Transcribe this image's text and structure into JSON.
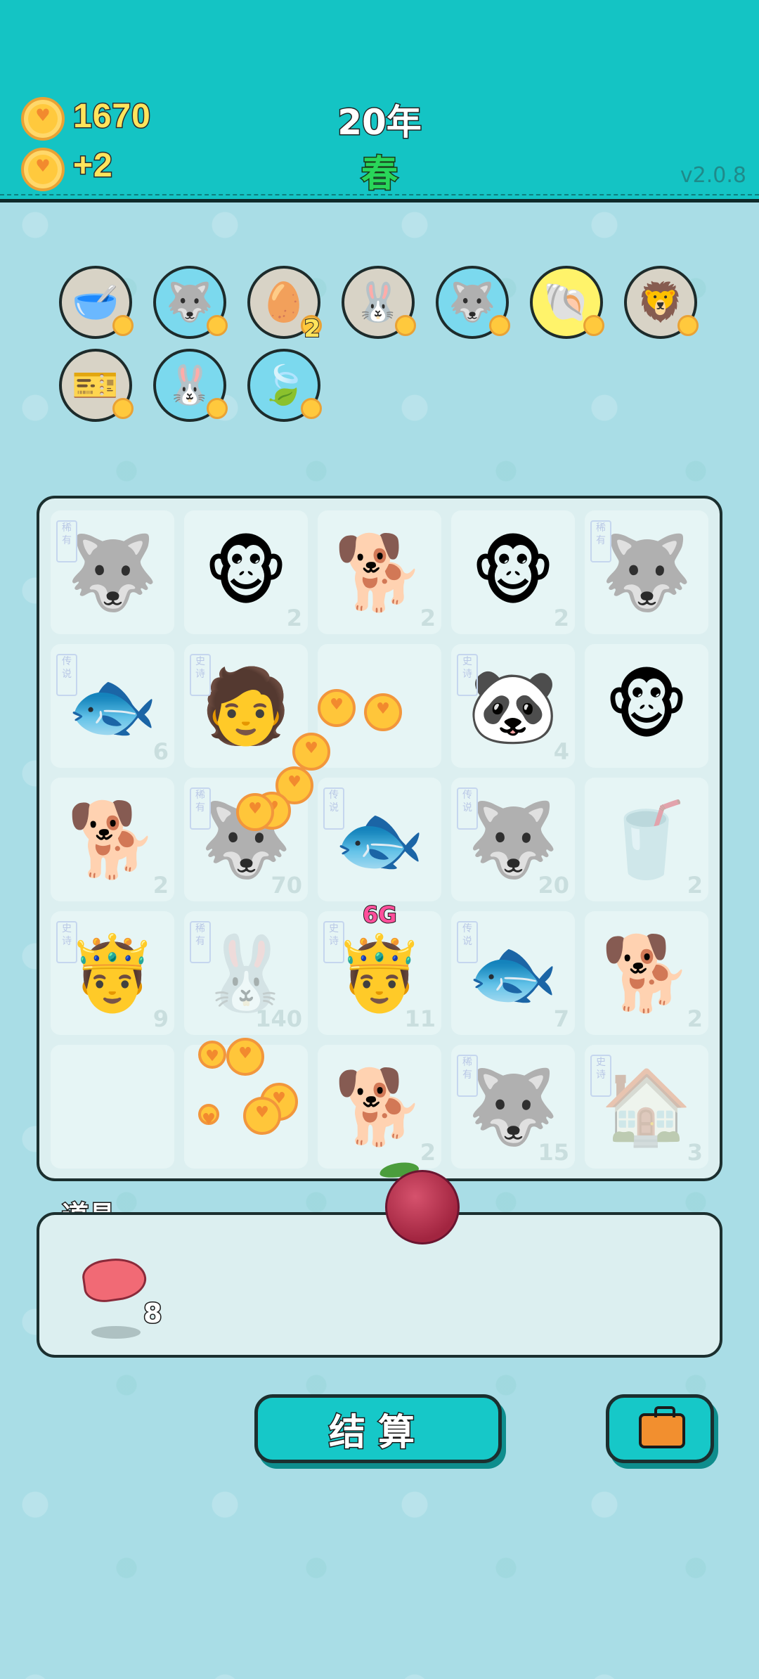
{
  "header": {
    "coins": "1670",
    "income": "+2",
    "year": "20年",
    "season": "春",
    "version": "v2.0.8"
  },
  "buffs": [
    {
      "icon": "🥣",
      "bg": "#d8d3c6"
    },
    {
      "icon": "🐺",
      "bg": "#7bd9ee"
    },
    {
      "icon": "🥚",
      "bg": "#d8d3c6",
      "count": "2"
    },
    {
      "icon": "🐰",
      "bg": "#d8d3c6"
    },
    {
      "icon": "🐺",
      "bg": "#7bd9ee"
    },
    {
      "icon": "🐚",
      "bg": "#fff36a"
    },
    {
      "icon": "🦁",
      "bg": "#d8d3c6"
    },
    {
      "icon": "🎫",
      "bg": "#d8d3c6"
    },
    {
      "icon": "🐰",
      "bg": "#7bd9ee"
    },
    {
      "icon": "🍃",
      "bg": "#7bd9ee"
    }
  ],
  "board": [
    [
      {
        "icon": "🐺",
        "level": "",
        "tag": "稀有"
      },
      {
        "icon": "🐵",
        "level": "2"
      },
      {
        "icon": "🐕",
        "level": "2"
      },
      {
        "icon": "🐵",
        "level": "2"
      },
      {
        "icon": "🐺",
        "level": "",
        "tag": "稀有"
      }
    ],
    [
      {
        "icon": "🐟",
        "level": "6",
        "tag": "传说"
      },
      {
        "icon": "🧑",
        "level": "",
        "tag": "史诗"
      },
      {
        "icon": "",
        "level": ""
      },
      {
        "icon": "🐼",
        "level": "4",
        "tag": "史诗"
      },
      {
        "icon": "🐵",
        "level": ""
      }
    ],
    [
      {
        "icon": "🐕",
        "level": "2"
      },
      {
        "icon": "🐺",
        "level": "70",
        "tag": "稀有"
      },
      {
        "icon": "🐟",
        "level": "",
        "tag": "传说"
      },
      {
        "icon": "🐺",
        "level": "20",
        "tag": "传说"
      },
      {
        "icon": "🥤",
        "level": "2",
        "faded": true
      }
    ],
    [
      {
        "icon": "🤴",
        "level": "9",
        "tag": "史诗"
      },
      {
        "icon": "🐰",
        "level": "140",
        "tag": "稀有",
        "faded": true
      },
      {
        "icon": "🤴",
        "level": "11",
        "tag": "史诗"
      },
      {
        "icon": "🐟",
        "level": "7",
        "tag": "传说"
      },
      {
        "icon": "🐕",
        "level": "2"
      }
    ],
    [
      {
        "icon": "",
        "level": ""
      },
      {
        "icon": "",
        "level": ""
      },
      {
        "icon": "🐕",
        "level": "2"
      },
      {
        "icon": "🐺",
        "level": "15",
        "tag": "稀有"
      },
      {
        "icon": "🏠",
        "level": "3",
        "tag": "史诗",
        "faded": true
      }
    ]
  ],
  "floating_badge": "6G",
  "items": {
    "title": "道具",
    "item_count": "8"
  },
  "buttons": {
    "settle": "结算"
  }
}
